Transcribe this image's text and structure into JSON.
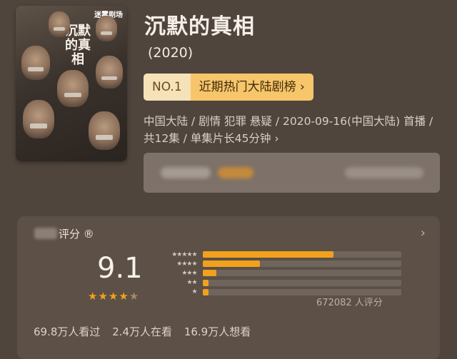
{
  "poster": {
    "brand": "迷雾剧场",
    "calligraphy": "沉默的真相"
  },
  "title": "沉默的真相",
  "year": "(2020)",
  "rank": {
    "no": "NO.1",
    "label": "近期热门大陆剧榜 ›"
  },
  "meta": "中国大陆 / 剧情 犯罪 悬疑 / 2020-09-16(中国大陆) 首播 / 共12集 / 单集片长45分钟 ›",
  "rating": {
    "label": "评分 ®",
    "arrow": "›",
    "score": "9.1",
    "stars_value": 4.5,
    "star_color": "#f2a11c",
    "count": "672082 人评分",
    "distribution": [
      {
        "stars": "★★★★★",
        "percent": 66
      },
      {
        "stars": "★★★★",
        "percent": 29
      },
      {
        "stars": "★★★",
        "percent": 7
      },
      {
        "stars": "★★",
        "percent": 3
      },
      {
        "stars": "★",
        "percent": 3
      }
    ]
  },
  "watch": {
    "watched": "69.8万人看过",
    "watching": "2.4万人在看",
    "want": "16.9万人想看"
  }
}
